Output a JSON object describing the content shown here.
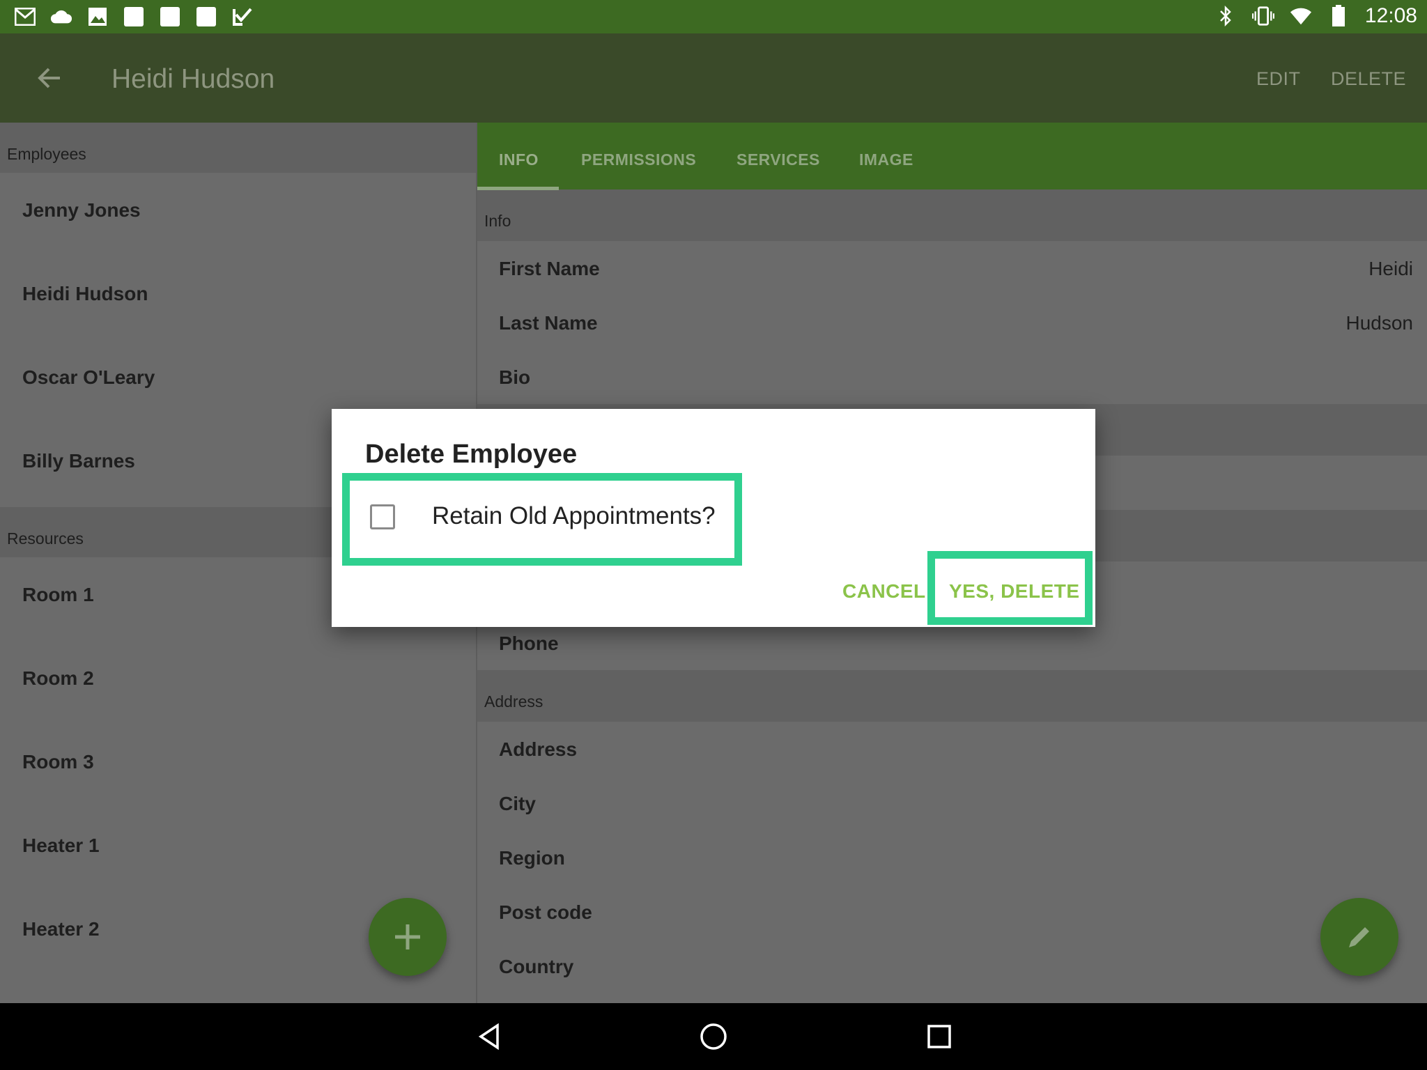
{
  "status_bar": {
    "time": "12:08",
    "left_icons": [
      "gmail-icon",
      "cloud-icon",
      "image-icon",
      "blank-notification-icon",
      "blank-notification-icon",
      "blank-notification-icon",
      "check-task-icon"
    ],
    "right_icons": [
      "bluetooth-icon",
      "vibrate-icon",
      "wifi-icon",
      "battery-icon"
    ]
  },
  "app_bar": {
    "title": "Heidi Hudson",
    "edit_label": "EDIT",
    "delete_label": "DELETE"
  },
  "left_pane": {
    "employees_header": "Employees",
    "employees": [
      "Jenny Jones",
      "Heidi Hudson",
      "Oscar O'Leary",
      "Billy Barnes"
    ],
    "resources_header": "Resources",
    "resources": [
      "Room 1",
      "Room 2",
      "Room 3",
      "Heater 1",
      "Heater 2"
    ]
  },
  "tabs": [
    "INFO",
    "PERMISSIONS",
    "SERVICES",
    "IMAGE"
  ],
  "info": {
    "section_info": "Info",
    "first_name_label": "First Name",
    "first_name_value": "Heidi",
    "last_name_label": "Last Name",
    "last_name_value": "Hudson",
    "bio_label": "Bio",
    "phone_label": "Phone",
    "section_address": "Address",
    "address_label": "Address",
    "city_label": "City",
    "region_label": "Region",
    "post_code_label": "Post code",
    "country_label": "Country"
  },
  "dialog": {
    "title": "Delete Employee",
    "checkbox_label": "Retain Old Appointments?",
    "checkbox_checked": false,
    "cancel_label": "CANCEL",
    "confirm_label": "YES, DELETE",
    "highlight_color": "#2fd08f",
    "button_color": "#8bc34a"
  },
  "colors": {
    "primary": "#3d6a22",
    "appbar_dimmed": "#3a4a29"
  }
}
